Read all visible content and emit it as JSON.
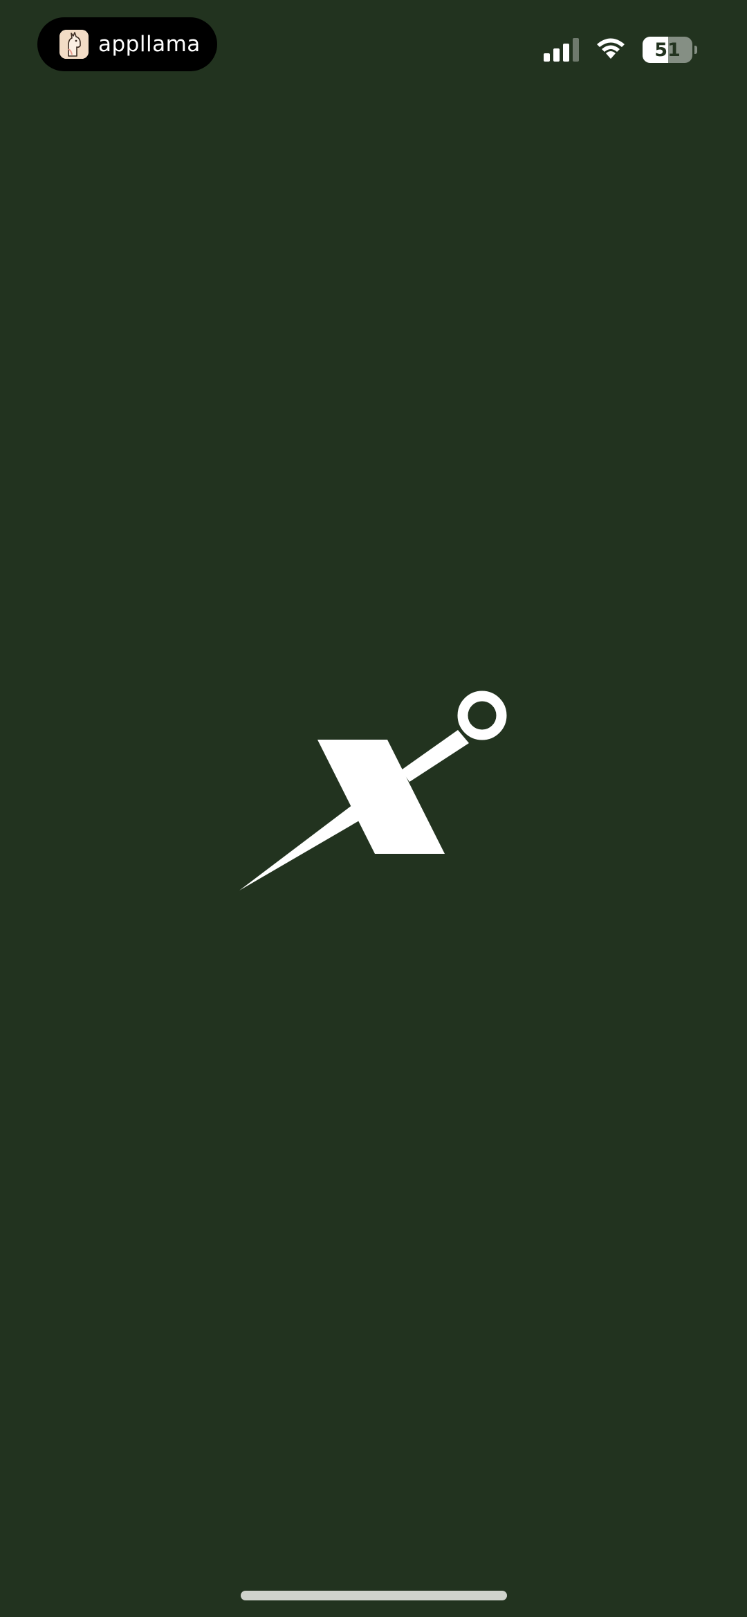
{
  "status_bar": {
    "app_pill_label": "appllama",
    "app_pill_icon": "llama-icon",
    "signal_icon": "cellular-signal-icon",
    "signal_bars_active": 3,
    "signal_bars_total": 4,
    "wifi_icon": "wifi-icon",
    "battery_percent": "51",
    "battery_level": 0.51
  },
  "splash": {
    "logo_icon": "needle-x-logo-icon"
  },
  "colors": {
    "background": "#22331f",
    "logo": "#ffffff",
    "home_indicator": "#cfd3cc"
  }
}
